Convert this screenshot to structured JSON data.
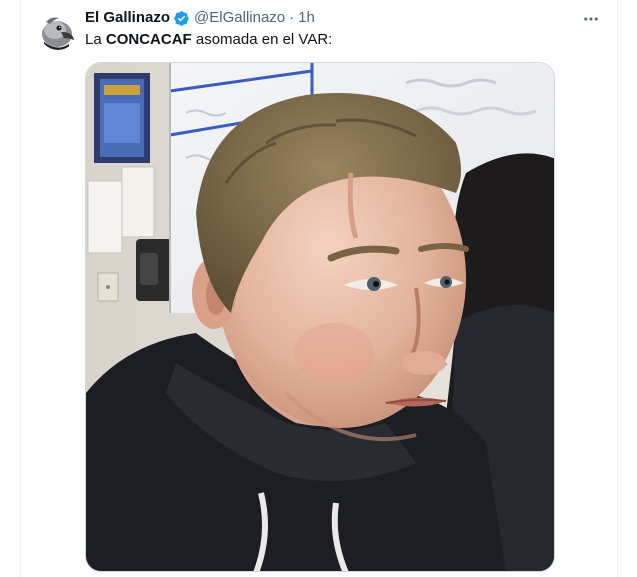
{
  "tweet": {
    "author": {
      "display_name": "El Gallinazo",
      "handle": "@ElGallinazo",
      "verified": true,
      "avatar_icon": "vulture-avatar-icon"
    },
    "separator": "·",
    "time": "1h",
    "text_prefix": "La ",
    "text_bold": "CONCACAF",
    "text_suffix": " asomada en el VAR:",
    "more_icon": "more-horizontal-icon",
    "media": {
      "kind": "photo",
      "description_icon": "meme-photo"
    }
  },
  "colors": {
    "text_primary": "#0f1419",
    "text_secondary": "#536471",
    "verified": "#1d9bf0",
    "border": "#cfd9de"
  }
}
